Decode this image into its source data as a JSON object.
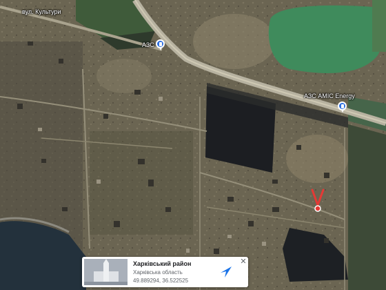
{
  "map": {
    "street_label": "вул. Культури",
    "poi": [
      {
        "id": "azs-1",
        "label": "АЗС"
      },
      {
        "id": "azs-2",
        "label": "АЗС AMIC Energy"
      }
    ],
    "marker": {
      "label": "V",
      "color": "#e53935"
    }
  },
  "info_card": {
    "title": "Харківський район",
    "subtitle": "Харківська область",
    "coords": "49.889294, 36.522525",
    "directions_icon": "directions-arrow-icon",
    "close_label": "✕"
  },
  "colors": {
    "lake": "#3f8b5c",
    "pin": "#2d6fe0",
    "marker": "#e53935",
    "directions": "#1a73e8"
  }
}
